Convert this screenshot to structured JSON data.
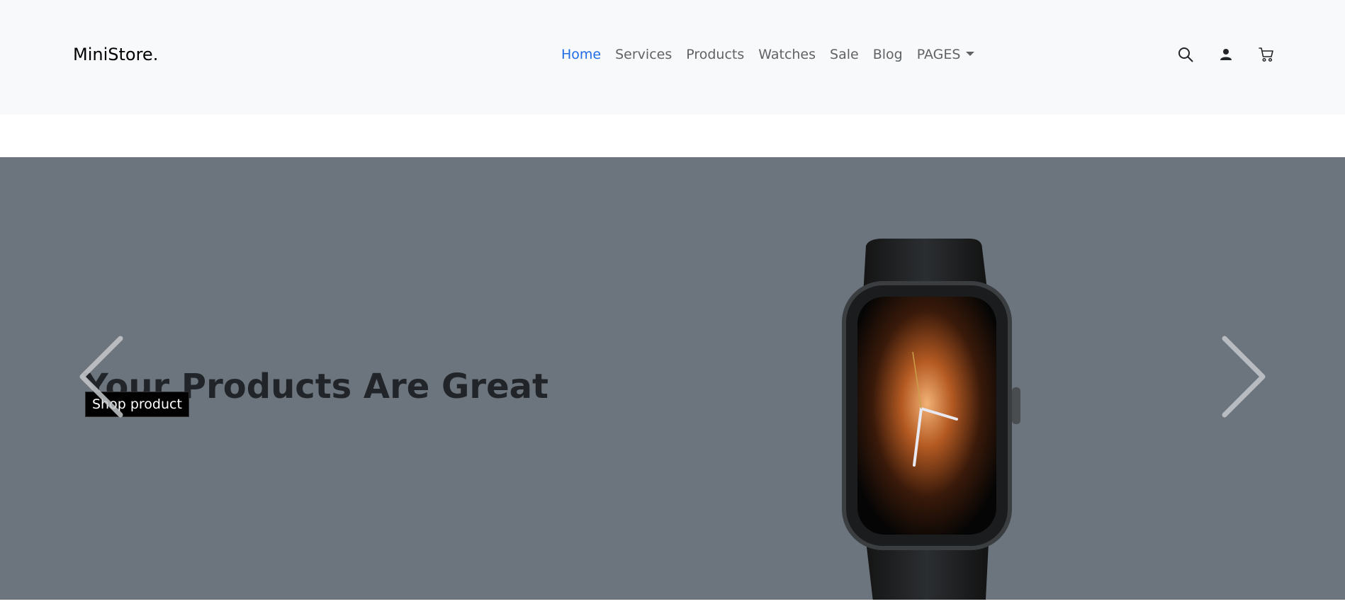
{
  "brand": {
    "name": "MiniStore."
  },
  "nav": {
    "links": [
      {
        "label": "Home",
        "active": true
      },
      {
        "label": "Services"
      },
      {
        "label": "Products"
      },
      {
        "label": "Watches"
      },
      {
        "label": "Sale"
      },
      {
        "label": "Blog"
      },
      {
        "label": "PAGES",
        "dropdown": true
      }
    ]
  },
  "header_icons": [
    "search-icon",
    "user-icon",
    "cart-icon"
  ],
  "hero": {
    "headline": "Your Products Are Great",
    "cta_label": "Shop product",
    "background": "#6c757d",
    "image": "smartwatch"
  },
  "colors": {
    "accent": "#1f6ee6",
    "navbar_bg": "#f8f9fa",
    "hero_bg": "#6c757d"
  }
}
